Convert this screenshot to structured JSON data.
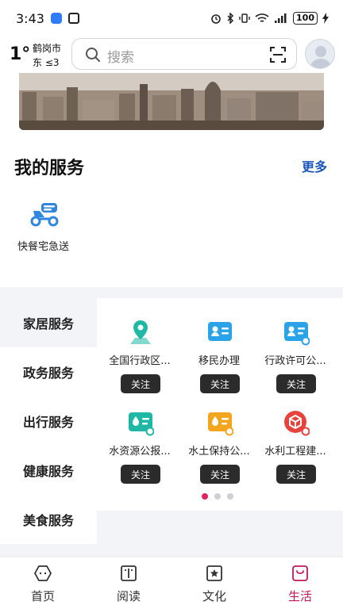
{
  "status_bar": {
    "time": "3:43",
    "battery": "100"
  },
  "weather": {
    "temp": "1°",
    "city": "鹤岗市",
    "wind": "东 ≤3"
  },
  "search": {
    "placeholder": "搜索"
  },
  "my_services": {
    "title": "我的服务",
    "more": "更多",
    "items": [
      {
        "label": "快餐宅急送",
        "icon": "scooter-icon"
      }
    ]
  },
  "categories": [
    {
      "label": "家居服务",
      "active": true
    },
    {
      "label": "政务服务",
      "active": false
    },
    {
      "label": "出行服务",
      "active": false
    },
    {
      "label": "健康服务",
      "active": false
    },
    {
      "label": "美食服务",
      "active": false
    }
  ],
  "grid": [
    {
      "label": "全国行政区...",
      "follow": "关注",
      "icon": "map-pin-icon",
      "color": "#1fb8a4"
    },
    {
      "label": "移民办理",
      "follow": "关注",
      "icon": "id-card-icon",
      "color": "#2aa3e8"
    },
    {
      "label": "行政许可公...",
      "follow": "关注",
      "icon": "license-icon",
      "color": "#2aa3e8"
    },
    {
      "label": "水资源公报...",
      "follow": "关注",
      "icon": "water-report-icon",
      "color": "#1fb8a4"
    },
    {
      "label": "水土保持公...",
      "follow": "关注",
      "icon": "soil-report-icon",
      "color": "#f2a51d"
    },
    {
      "label": "水利工程建...",
      "follow": "关注",
      "icon": "engineering-icon",
      "color": "#e8423d"
    }
  ],
  "pagination": {
    "pages": 3,
    "current": 1
  },
  "bottom_nav": [
    {
      "label": "首页",
      "icon": "home-icon",
      "active": false
    },
    {
      "label": "阅读",
      "icon": "book-icon",
      "active": false
    },
    {
      "label": "文化",
      "icon": "culture-star-icon",
      "active": false
    },
    {
      "label": "生活",
      "icon": "life-bag-icon",
      "active": true
    }
  ],
  "colors": {
    "accent": "#c2185b",
    "link": "#1b56b8",
    "page_dot_active": "#e0245e"
  }
}
